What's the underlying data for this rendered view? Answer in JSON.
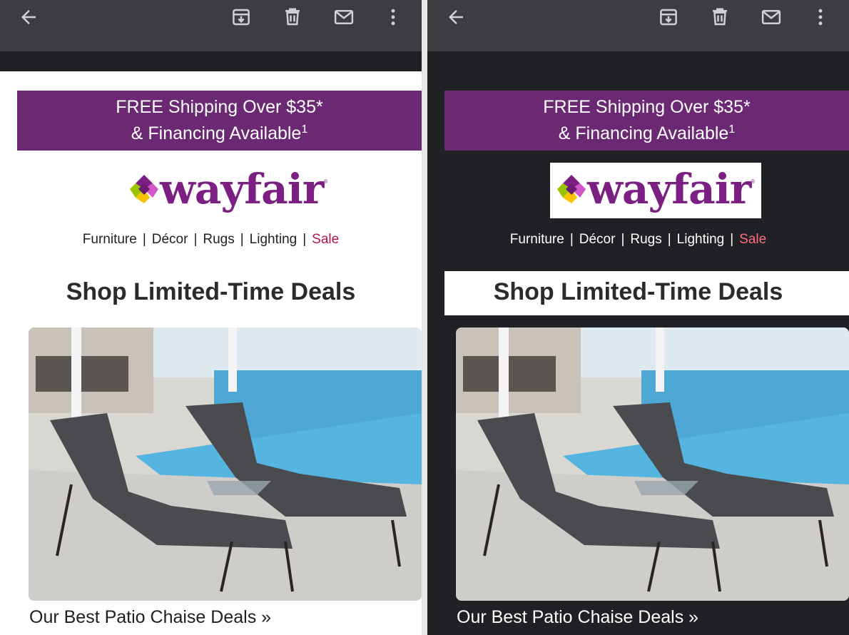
{
  "toolbar": {
    "back_icon": "arrow-left-icon",
    "archive_icon": "archive-icon",
    "delete_icon": "trash-icon",
    "mark_unread_icon": "mail-icon",
    "more_icon": "more-vertical-icon"
  },
  "email": {
    "promo_line1": "FREE Shipping Over $35*",
    "promo_line2": "& Financing Available",
    "promo_footnote": "1",
    "logo_text": "wayfair",
    "logo_mark": "®",
    "nav": [
      "Furniture",
      "Décor",
      "Rugs",
      "Lighting",
      "Sale"
    ],
    "nav_separator": "|",
    "heading": "Shop Limited-Time Deals",
    "hero_caption": "Our Best Patio Chaise Deals »"
  },
  "colors": {
    "promo_bg": "#6b2873",
    "brand_purple": "#7b1f82",
    "sale_light": "#b0154f",
    "sale_dark": "#ff6b7a",
    "appbar": "#3c3d41",
    "dark_bg": "#202124"
  }
}
